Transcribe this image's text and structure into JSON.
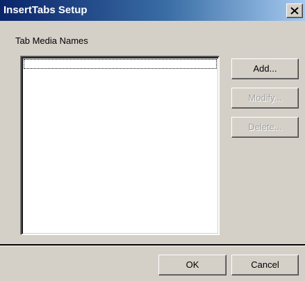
{
  "window": {
    "title": "InsertTabs Setup"
  },
  "main": {
    "section_label": "Tab Media Names",
    "list_items": []
  },
  "buttons": {
    "add": "Add...",
    "modify": "Modify...",
    "delete": "Delete...",
    "ok": "OK",
    "cancel": "Cancel"
  },
  "colors": {
    "titlebar_start": "#0a246a",
    "titlebar_end": "#a6caf0",
    "face": "#d4d0c8",
    "disabled_text": "#a0a0a0"
  }
}
